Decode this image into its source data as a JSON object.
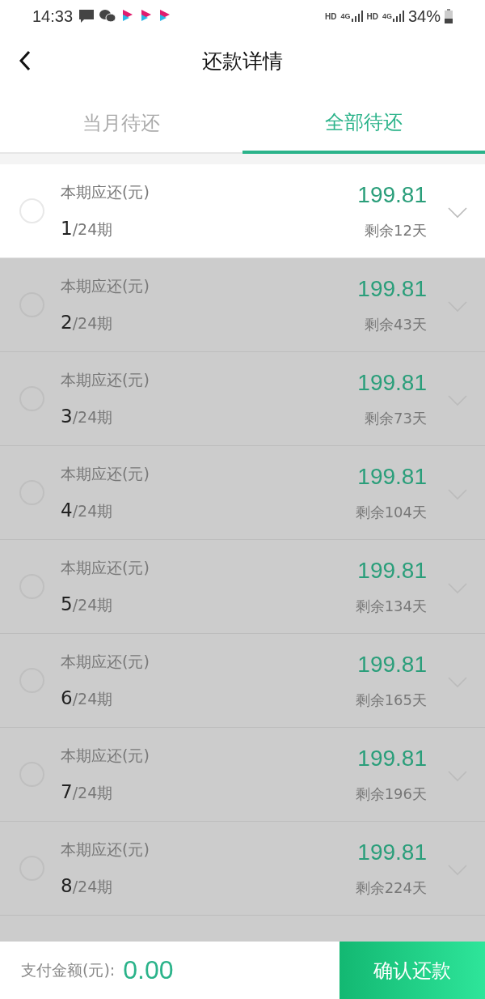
{
  "status_bar": {
    "time": "14:33",
    "network": [
      {
        "hd": "HD",
        "gen": "4G"
      },
      {
        "hd": "HD",
        "gen": "4G"
      }
    ],
    "battery": "34%",
    "notification_icons": [
      {
        "kind": "message"
      },
      {
        "kind": "chat"
      },
      {
        "kind": "play"
      },
      {
        "kind": "play"
      },
      {
        "kind": "play"
      }
    ]
  },
  "header": {
    "title": "还款详情"
  },
  "tabs": [
    {
      "label": "当月待还",
      "selected": false
    },
    {
      "label": "全部待还",
      "selected": true
    }
  ],
  "installments": [
    {
      "label": "本期应还(元)",
      "amount": "199.81",
      "number": "1",
      "total": "/24期",
      "remaining": "剩余12天",
      "disabled": false,
      "checked": false
    },
    {
      "label": "本期应还(元)",
      "amount": "199.81",
      "number": "2",
      "total": "/24期",
      "remaining": "剩余43天",
      "disabled": true,
      "checked": false
    },
    {
      "label": "本期应还(元)",
      "amount": "199.81",
      "number": "3",
      "total": "/24期",
      "remaining": "剩余73天",
      "disabled": true,
      "checked": false
    },
    {
      "label": "本期应还(元)",
      "amount": "199.81",
      "number": "4",
      "total": "/24期",
      "remaining": "剩余104天",
      "disabled": true,
      "checked": false
    },
    {
      "label": "本期应还(元)",
      "amount": "199.81",
      "number": "5",
      "total": "/24期",
      "remaining": "剩余134天",
      "disabled": true,
      "checked": false
    },
    {
      "label": "本期应还(元)",
      "amount": "199.81",
      "number": "6",
      "total": "/24期",
      "remaining": "剩余165天",
      "disabled": true,
      "checked": false
    },
    {
      "label": "本期应还(元)",
      "amount": "199.81",
      "number": "7",
      "total": "/24期",
      "remaining": "剩余196天",
      "disabled": true,
      "checked": false
    },
    {
      "label": "本期应还(元)",
      "amount": "199.81",
      "number": "8",
      "total": "/24期",
      "remaining": "剩余224天",
      "disabled": true,
      "checked": false
    }
  ],
  "footer": {
    "label": "支付金额(元):",
    "amount": "0.00",
    "button": "确认还款"
  }
}
